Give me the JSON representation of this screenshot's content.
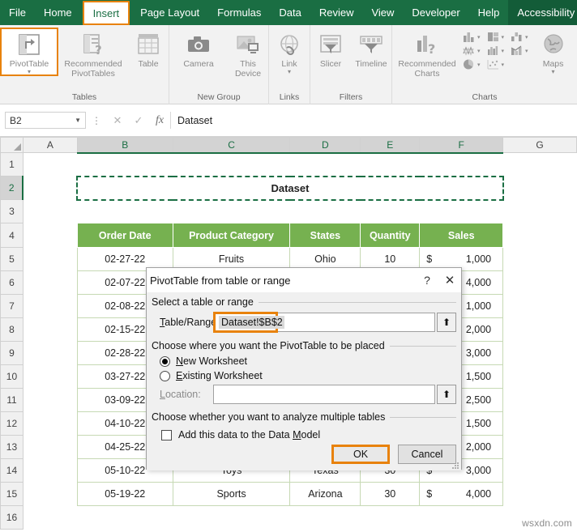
{
  "ribbon": {
    "tabs": [
      {
        "label": "File",
        "active": false
      },
      {
        "label": "Home",
        "active": false
      },
      {
        "label": "Insert",
        "active": true
      },
      {
        "label": "Page Layout",
        "active": false
      },
      {
        "label": "Formulas",
        "active": false
      },
      {
        "label": "Data",
        "active": false
      },
      {
        "label": "Review",
        "active": false
      },
      {
        "label": "View",
        "active": false
      },
      {
        "label": "Developer",
        "active": false
      },
      {
        "label": "Help",
        "active": false
      },
      {
        "label": "Accessibility",
        "active": false
      }
    ],
    "groups": [
      {
        "name": "Tables",
        "label": "Tables",
        "buttons": [
          {
            "label": "PivotTable",
            "icon": "pivot-table-icon",
            "highlighted": true,
            "dropdown": true
          },
          {
            "label": "Recommended\nPivotTables",
            "icon": "recommended-pivottables-icon",
            "highlighted": false,
            "dropdown": false
          },
          {
            "label": "Table",
            "icon": "table-icon",
            "highlighted": false,
            "dropdown": false
          }
        ]
      },
      {
        "name": "New Group",
        "label": "New Group",
        "buttons": [
          {
            "label": "Camera",
            "icon": "camera-icon",
            "highlighted": false,
            "dropdown": false
          },
          {
            "label": "This\nDevice",
            "icon": "this-device-icon",
            "highlighted": false,
            "dropdown": false
          }
        ]
      },
      {
        "name": "Links",
        "label": "Links",
        "buttons": [
          {
            "label": "Link",
            "icon": "link-globe-icon",
            "highlighted": false,
            "dropdown": true
          }
        ]
      },
      {
        "name": "Filters",
        "label": "Filters",
        "buttons": [
          {
            "label": "Slicer",
            "icon": "slicer-icon",
            "highlighted": false,
            "dropdown": false
          },
          {
            "label": "Timeline",
            "icon": "timeline-icon",
            "highlighted": false,
            "dropdown": false
          }
        ]
      },
      {
        "name": "Charts",
        "label": "Charts",
        "buttons": [
          {
            "label": "Recommended\nCharts",
            "icon": "recommended-charts-icon",
            "highlighted": false,
            "dropdown": false
          },
          {
            "label": "Maps",
            "icon": "maps-globe-icon",
            "highlighted": false,
            "dropdown": true
          }
        ],
        "mini_icons": [
          [
            "column-chart-icon",
            "bar-chart-icon",
            "waterfall-chart-icon"
          ],
          [
            "line-chart-icon",
            "histogram-chart-icon",
            "combo-chart-icon"
          ],
          [
            "pie-chart-icon",
            "scatter-chart-icon"
          ]
        ]
      }
    ]
  },
  "formula_bar": {
    "name_box": "B2",
    "cancel_icon": "cancel-icon",
    "confirm_icon": "confirm-icon",
    "function_icon": "insert-function-icon",
    "value": "Dataset"
  },
  "sheet": {
    "columns": [
      "A",
      "B",
      "C",
      "D",
      "E",
      "F",
      "G"
    ],
    "selected_columns": [
      "B",
      "C",
      "D",
      "E",
      "F"
    ],
    "rows": [
      "1",
      "2",
      "3",
      "4",
      "5",
      "6",
      "7",
      "8",
      "9",
      "10",
      "11",
      "12",
      "13",
      "14",
      "15",
      "16"
    ],
    "selected_row": "2",
    "title_cell": "Dataset",
    "table_headers": [
      "Order Date",
      "Product Category",
      "States",
      "Quantity",
      "Sales"
    ],
    "table_rows": [
      {
        "date": "02-27-22",
        "category": "Fruits",
        "state": "Ohio",
        "qty": "10",
        "currency": "$",
        "sales": "1,000"
      },
      {
        "date": "02-07-22",
        "category": "",
        "state": "",
        "qty": "",
        "currency": "",
        "sales": "4,000"
      },
      {
        "date": "02-08-22",
        "category": "",
        "state": "",
        "qty": "",
        "currency": "",
        "sales": "1,000"
      },
      {
        "date": "02-15-22",
        "category": "",
        "state": "",
        "qty": "",
        "currency": "",
        "sales": "2,000"
      },
      {
        "date": "02-28-22",
        "category": "",
        "state": "",
        "qty": "",
        "currency": "",
        "sales": "3,000"
      },
      {
        "date": "03-27-22",
        "category": "",
        "state": "",
        "qty": "",
        "currency": "",
        "sales": "1,500"
      },
      {
        "date": "03-09-22",
        "category": "",
        "state": "",
        "qty": "",
        "currency": "",
        "sales": "2,500"
      },
      {
        "date": "04-10-22",
        "category": "",
        "state": "",
        "qty": "",
        "currency": "",
        "sales": "1,500"
      },
      {
        "date": "04-25-22",
        "category": "",
        "state": "",
        "qty": "",
        "currency": "",
        "sales": "2,000"
      },
      {
        "date": "05-10-22",
        "category": "Toys",
        "state": "Texas",
        "qty": "30",
        "currency": "$",
        "sales": "3,000"
      },
      {
        "date": "05-19-22",
        "category": "Sports",
        "state": "Arizona",
        "qty": "30",
        "currency": "$",
        "sales": "4,000"
      }
    ]
  },
  "dialog": {
    "title": "PivotTable from table or range",
    "help_icon": "help-question-icon",
    "close_icon": "close-icon",
    "section1_label": "Select a table or range",
    "table_range_label": "Table/Range:",
    "table_range_value": "Dataset!$B$2",
    "collapse_icon": "collapse-dialog-icon",
    "section2_label": "Choose where you want the PivotTable to be placed",
    "radio_new": "New Worksheet",
    "radio_existing": "Existing Worksheet",
    "selected_placement": "New Worksheet",
    "location_label": "Location:",
    "location_value": "",
    "section3_label": "Choose whether you want to analyze multiple tables",
    "checkbox_data_model": "Add this data to the Data Model",
    "data_model_checked": false,
    "ok_label": "OK",
    "cancel_label": "Cancel"
  },
  "watermark": "wsxdn.com",
  "colors": {
    "ribbon_green": "#1a6e43",
    "highlight_orange": "#e8820c",
    "table_header_green": "#76b150",
    "title_text_navy": "#1f3864"
  }
}
